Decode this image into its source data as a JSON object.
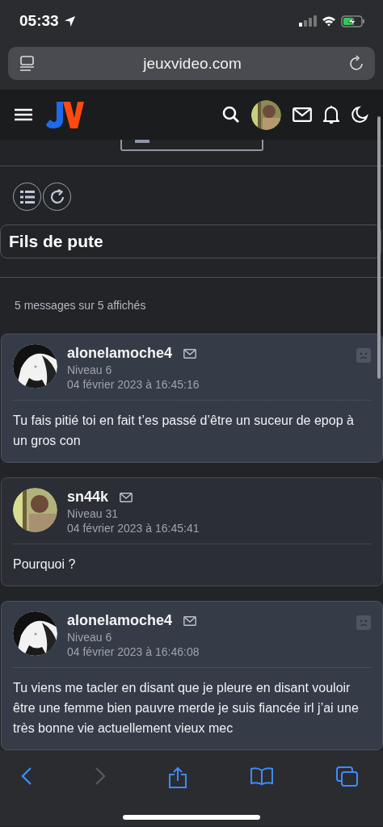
{
  "status_bar": {
    "time": "05:33"
  },
  "browser": {
    "url": "jeuxvideo.com"
  },
  "topic": {
    "title": "Fils de pute",
    "count": "5 messages sur 5 affichés"
  },
  "posts": [
    {
      "author": "alonelamoche4",
      "level": "Niveau 6",
      "date": "04 février 2023 à 16:45:16",
      "text": "Tu fais pitié toi en fait t’es passé d’être un suceur de epop à un gros con",
      "highlighted": true
    },
    {
      "author": "sn44k",
      "level": "Niveau 31",
      "date": "04 février 2023 à 16:45:41",
      "text": "Pourquoi ?",
      "highlighted": false
    },
    {
      "author": "alonelamoche4",
      "level": "Niveau 6",
      "date": "04 février 2023 à 16:46:08",
      "text": "Tu viens me tacler en disant que je pleure en disant vouloir être une femme bien pauvre merde je suis fiancée irl j’ai une très bonne vie actuellement vieux mec",
      "highlighted": true
    }
  ]
}
